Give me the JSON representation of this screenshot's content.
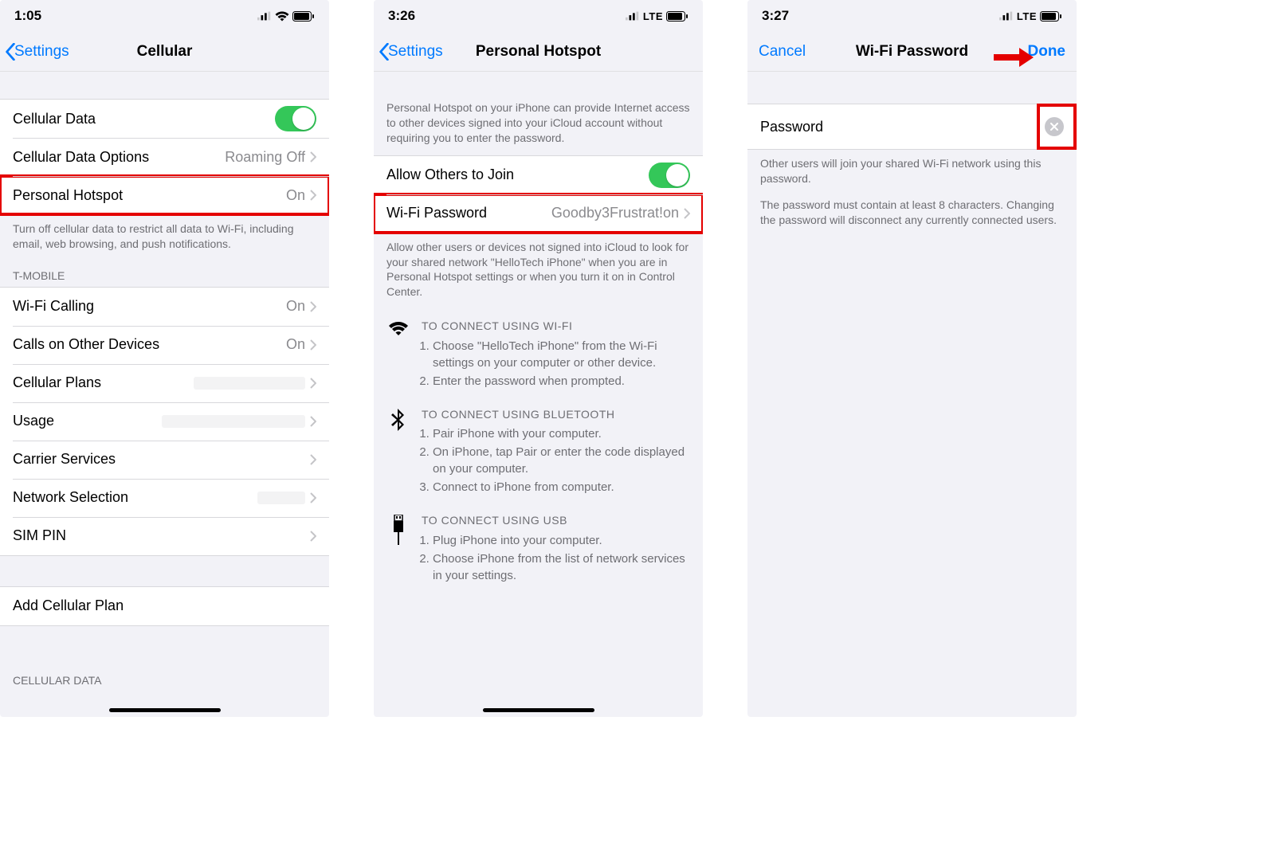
{
  "screen1": {
    "time": "1:05",
    "nav_back": "Settings",
    "nav_title": "Cellular",
    "rows": {
      "cellular_data": "Cellular Data",
      "cellular_data_options": "Cellular Data Options",
      "cellular_data_options_value": "Roaming Off",
      "personal_hotspot": "Personal Hotspot",
      "personal_hotspot_value": "On",
      "footer1": "Turn off cellular data to restrict all data to Wi-Fi, including email, web browsing, and push notifications.",
      "carrier_header": "T-MOBILE",
      "wifi_calling": "Wi-Fi Calling",
      "wifi_calling_value": "On",
      "calls_other": "Calls on Other Devices",
      "calls_other_value": "On",
      "cellular_plans": "Cellular Plans",
      "usage": "Usage",
      "carrier_services": "Carrier Services",
      "network_selection": "Network Selection",
      "sim_pin": "SIM PIN",
      "add_plan": "Add Cellular Plan",
      "data_header": "CELLULAR DATA"
    }
  },
  "screen2": {
    "time": "3:26",
    "network": "LTE",
    "nav_back": "Settings",
    "nav_title": "Personal Hotspot",
    "header_text": "Personal Hotspot on your iPhone can provide Internet access to other devices signed into your iCloud account without requiring you to enter the password.",
    "allow_others": "Allow Others to Join",
    "wifi_password_label": "Wi-Fi Password",
    "wifi_password_value": "Goodby3Frustrat!on",
    "footer2": "Allow other users or devices not signed into iCloud to look for your shared network \"HelloTech iPhone\" when you are in Personal Hotspot settings or when you turn it on in Control Center.",
    "wifi_title": "TO CONNECT USING WI-FI",
    "wifi_step1": "Choose \"HelloTech iPhone\" from the Wi-Fi settings on your computer or other device.",
    "wifi_step2": "Enter the password when prompted.",
    "bt_title": "TO CONNECT USING BLUETOOTH",
    "bt_step1": "Pair iPhone with your computer.",
    "bt_step2": "On iPhone, tap Pair or enter the code displayed on your computer.",
    "bt_step3": "Connect to iPhone from computer.",
    "usb_title": "TO CONNECT USING USB",
    "usb_step1": "Plug iPhone into your computer.",
    "usb_step2": "Choose iPhone from the list of network services in your settings."
  },
  "screen3": {
    "time": "3:27",
    "network": "LTE",
    "nav_cancel": "Cancel",
    "nav_title": "Wi-Fi Password",
    "nav_done": "Done",
    "password_label": "Password",
    "footer_a": "Other users will join your shared Wi-Fi network using this password.",
    "footer_b": "The password must contain at least 8 characters. Changing the password will disconnect any currently connected users."
  }
}
